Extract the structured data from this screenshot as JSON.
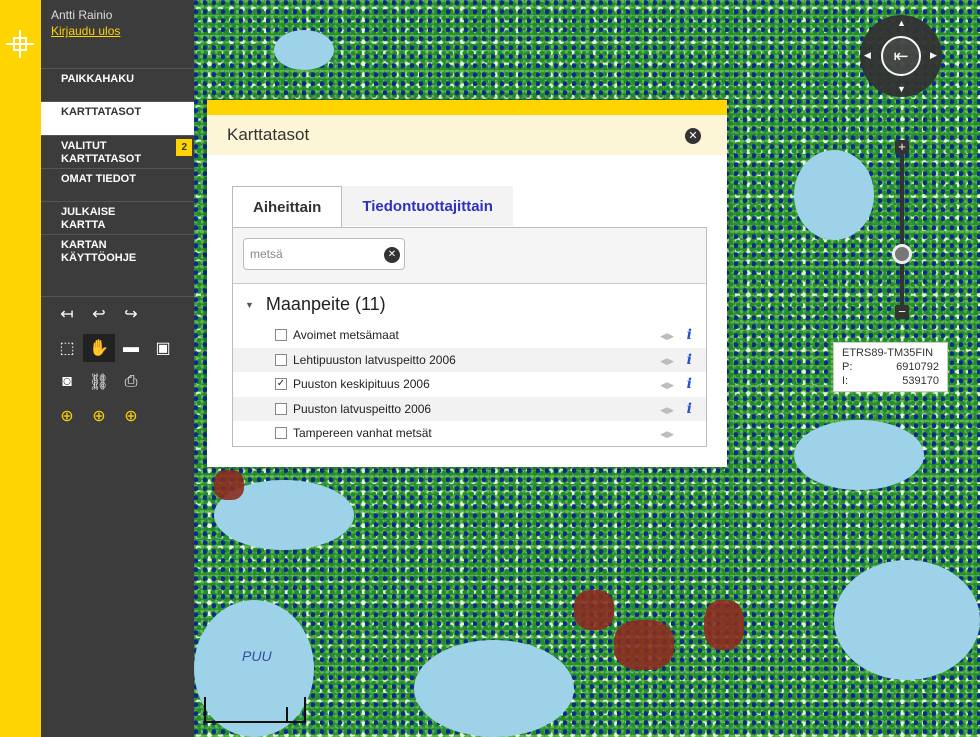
{
  "user": {
    "name": "Antti Rainio",
    "logout": "Kirjaudu ulos"
  },
  "menu": {
    "search": "PAIKKAHAKU",
    "layers": "KARTTATASOT",
    "selected_line1": "VALITUT",
    "selected_line2": "KARTTATASOT",
    "selected_badge": "2",
    "my_data": "OMAT TIEDOT",
    "publish_line1": "JULKAISE",
    "publish_line2": "KARTTA",
    "guide_line1": "KARTAN",
    "guide_line2": "KÄYTTÖOHJE"
  },
  "dialog": {
    "title": "Karttatasot",
    "close_glyph": "✕",
    "tabs": [
      "Aiheittain",
      "Tiedontuottajittain"
    ],
    "search_value": "metsä",
    "clear_glyph": "✕",
    "group": "Maanpeite (11)",
    "layers": [
      {
        "name": "Avoimet metsämaat",
        "checked": false,
        "info": true
      },
      {
        "name": "Lehtipuuston latvuspeitto 2006",
        "checked": false,
        "info": true
      },
      {
        "name": "Puuston keskipituus 2006",
        "checked": true,
        "info": true
      },
      {
        "name": "Puuston latvuspeitto 2006",
        "checked": false,
        "info": true
      },
      {
        "name": "Tampereen vanhat metsät",
        "checked": false,
        "info": false
      }
    ]
  },
  "coords": {
    "system": "ETRS89-TM35FIN",
    "p_label": "P:",
    "p_value": "6910792",
    "i_label": "I:",
    "i_value": "539170"
  },
  "map_labels": [
    "PUU"
  ],
  "colors": {
    "accent": "#ffd400",
    "sidebar": "#3c3c3c"
  }
}
